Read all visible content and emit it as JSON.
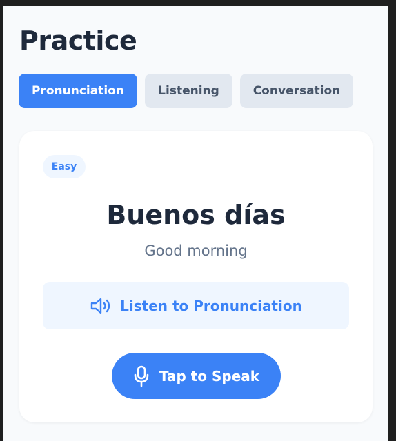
{
  "page": {
    "title": "Practice"
  },
  "tabs": [
    {
      "label": "Pronunciation",
      "active": true
    },
    {
      "label": "Listening",
      "active": false
    },
    {
      "label": "Conversation",
      "active": false
    }
  ],
  "card": {
    "difficulty": "Easy",
    "phrase": "Buenos días",
    "translation": "Good morning",
    "listen_label": "Listen to Pronunciation",
    "listen_icon": "speaker-icon",
    "speak_label": "Tap to Speak",
    "speak_icon": "microphone-icon"
  },
  "colors": {
    "accent": "#3b82f6",
    "accent_light": "#eff6ff",
    "text_dark": "#1e293b",
    "text_muted": "#64748b",
    "tab_inactive_bg": "#e2e8f0"
  }
}
